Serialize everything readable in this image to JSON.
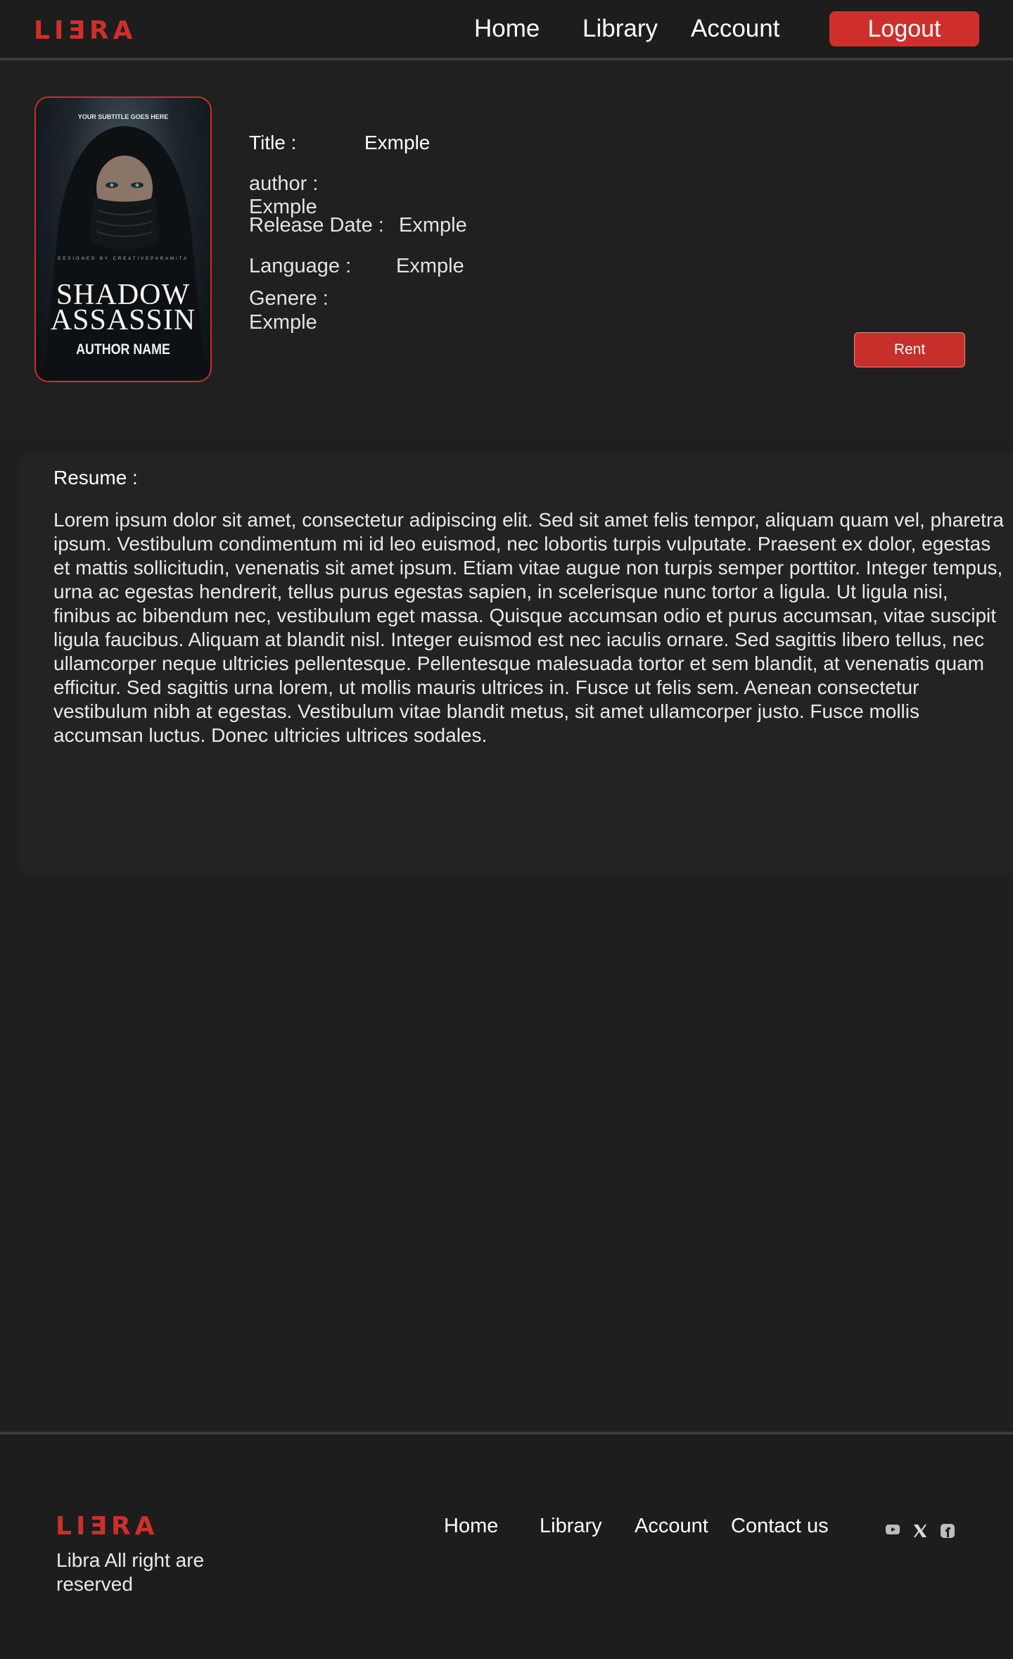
{
  "header": {
    "logo": "LIƎRA",
    "nav": {
      "home": "Home",
      "library": "Library",
      "account": "Account"
    },
    "logout_label": "Logout"
  },
  "book": {
    "cover": {
      "subtitle": "YOUR SUBTITLE GOES HERE",
      "designed_by": "DESIGNED BY CREATIVEPARAMITA",
      "title_line1": "SHADOW",
      "title_line2": "ASSASSIN",
      "author": "AUTHOR NAME"
    },
    "title_label": "Title :",
    "title_value": "Exmple",
    "author_label": "author :",
    "author_value": "Exmple",
    "release_label": "Release Date :",
    "release_value": "Exmple",
    "language_label": "Language :",
    "language_value": "Exmple",
    "genre_label": "Genere :",
    "genre_value": "Exmple",
    "rent_label": "Rent"
  },
  "resume": {
    "heading": "Resume :",
    "text": "Lorem ipsum dolor sit amet, consectetur adipiscing elit. Sed sit amet felis tempor, aliquam quam vel, pharetra ipsum. Vestibulum condimentum mi id leo euismod, nec lobortis turpis vulputate. Praesent ex dolor, egestas et mattis sollicitudin, venenatis sit amet ipsum. Etiam vitae augue non turpis semper porttitor. Integer tempus, urna ac egestas hendrerit, tellus purus egestas sapien, in scelerisque nunc tortor a ligula. Ut ligula nisi, finibus ac bibendum nec, vestibulum eget massa. Quisque accumsan odio et purus accumsan, vitae suscipit ligula faucibus. Aliquam at blandit nisl. Integer euismod est nec iaculis ornare. Sed sagittis libero tellus, nec ullamcorper neque ultricies pellentesque. Pellentesque malesuada tortor et sem blandit, at venenatis quam efficitur. Sed sagittis urna lorem, ut mollis mauris ultrices in. Fusce ut felis sem. Aenean consectetur vestibulum nibh at egestas. Vestibulum vitae blandit metus, sit amet ullamcorper justo. Fusce mollis accumsan luctus. Donec ultricies ultrices sodales."
  },
  "footer": {
    "logo": "LIƎRA",
    "rights": "Libra All right are reserved",
    "links": {
      "home": "Home",
      "library": "Library",
      "account": "Account",
      "contact": "Contact us"
    },
    "social": [
      "youtube-icon",
      "x-icon",
      "facebook-icon"
    ]
  },
  "colors": {
    "accent": "#cf2f2a",
    "background": "#1f1f20",
    "panel": "#232324"
  }
}
